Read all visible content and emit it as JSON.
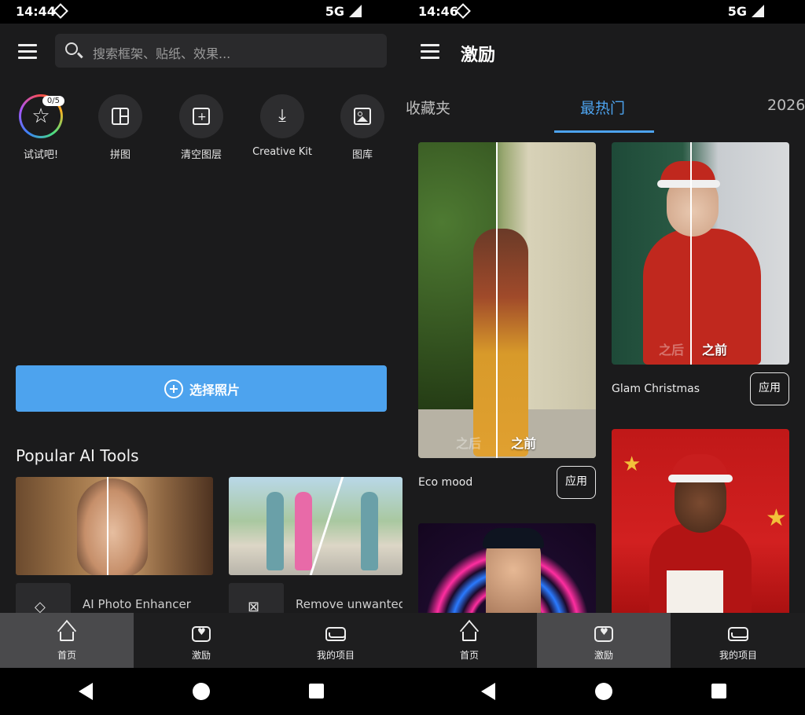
{
  "left": {
    "status": {
      "time": "14:44",
      "network": "5G"
    },
    "search": {
      "placeholder": "搜索框架、贴纸、效果..."
    },
    "quick_tools": [
      {
        "label": "试试吧!",
        "icon": "star-icon",
        "badge": "0/5"
      },
      {
        "label": "拼图",
        "icon": "collage-icon"
      },
      {
        "label": "清空图层",
        "icon": "layers-icon"
      },
      {
        "label": "Creative Kit",
        "icon": "download-icon"
      },
      {
        "label": "图库",
        "icon": "gallery-icon"
      }
    ],
    "select_button": {
      "label": "选择照片"
    },
    "section_title": "Popular AI Tools",
    "ai_tools": [
      {
        "label": "AI Photo Enhancer",
        "icon": "diamond-icon"
      },
      {
        "label": "Remove unwanted",
        "icon": "crop-remove-icon"
      }
    ],
    "bottom_nav": [
      {
        "label": "首页",
        "icon": "home-icon",
        "active": true
      },
      {
        "label": "激励",
        "icon": "inspire-icon",
        "active": false
      },
      {
        "label": "我的项目",
        "icon": "projects-icon",
        "active": false
      }
    ]
  },
  "right": {
    "status": {
      "time": "14:46",
      "network": "5G"
    },
    "title": "激励",
    "tabs": [
      "收藏夹",
      "最热门",
      "2026"
    ],
    "cards": [
      {
        "label": "Eco mood",
        "apply": "应用",
        "before": "之前",
        "after": "之后"
      },
      {
        "label": "Glam Christmas",
        "apply": "应用",
        "before": "之前",
        "after": "之后"
      }
    ],
    "bottom_nav": [
      {
        "label": "首页",
        "icon": "home-icon",
        "active": false
      },
      {
        "label": "激励",
        "icon": "inspire-icon",
        "active": true
      },
      {
        "label": "我的项目",
        "icon": "projects-icon",
        "active": false
      }
    ]
  },
  "colors": {
    "accent": "#4da3ee",
    "background": "#1b1b1c",
    "nav_active": "#4a4a4c"
  }
}
